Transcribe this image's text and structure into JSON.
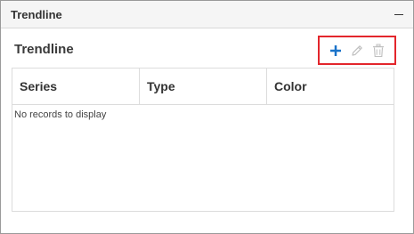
{
  "panel": {
    "title": "Trendline"
  },
  "section": {
    "title": "Trendline"
  },
  "toolbar": {
    "add_icon": "plus-icon",
    "edit_icon": "pencil-icon",
    "delete_icon": "trash-icon",
    "add_color": "#1a73c9",
    "disabled_color": "#bfbfbf",
    "highlight_color": "#e3262c"
  },
  "grid": {
    "columns": [
      "Series",
      "Type",
      "Color"
    ],
    "empty_message": "No records to display"
  }
}
